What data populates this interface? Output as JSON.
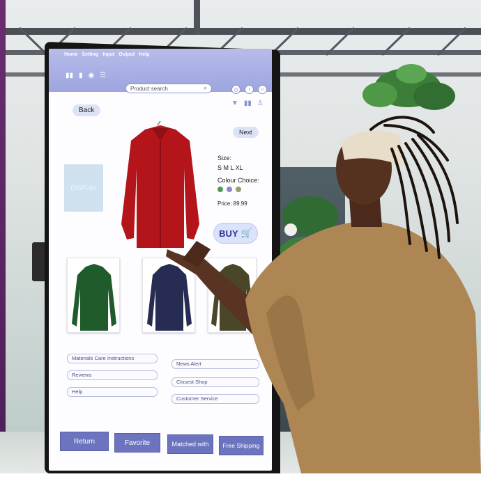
{
  "menu": [
    "Home",
    "Setting",
    "Input",
    "Output",
    "Help"
  ],
  "search": {
    "placeholder": "Product search"
  },
  "nav": {
    "back": "Back",
    "next": "Next"
  },
  "ghost_text": "DISPLAY",
  "product": {
    "size_label": "Size:",
    "sizes": "S  M  L  XL",
    "colour_label": "Colour Choice:",
    "colours": [
      "#4f9a58",
      "#8d86cf",
      "#9c9c70"
    ],
    "price": "Price: 89.99",
    "buy": "BUY"
  },
  "links": {
    "left": [
      "Materials Care Instructions",
      "Reviews",
      "Help"
    ],
    "right": [
      "News Alert",
      "Closest Shop",
      "Customer Service"
    ]
  },
  "buttons": [
    "Return",
    "Favorite",
    "Matched with",
    "Free Shipping"
  ],
  "colors": {
    "accent": "#6c74bf",
    "topbar": "#aab0e4"
  }
}
